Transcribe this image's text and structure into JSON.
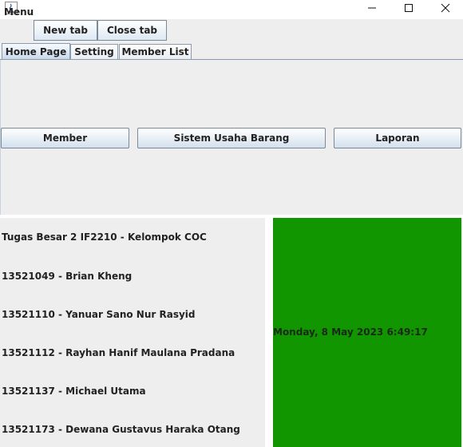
{
  "window": {
    "controls": [
      "minimize-icon",
      "maximize-icon",
      "close-icon"
    ]
  },
  "menubar": {
    "menu_label": "Menu",
    "new_tab_label": "New tab",
    "close_tab_label": "Close tab"
  },
  "tabs": [
    {
      "label": "Home Page",
      "active": true
    },
    {
      "label": "Setting",
      "active": false
    },
    {
      "label": "Member List",
      "active": false
    }
  ],
  "home": {
    "buttons": {
      "member": "Member",
      "sistem_usaha_barang": "Sistem Usaha Barang",
      "laporan": "Laporan"
    },
    "info_lines": [
      "Tugas Besar 2 IF2210 - Kelompok COC",
      "13521049 - Brian Kheng",
      "13521110 - Yanuar Sano Nur Rasyid",
      "13521112 - Rayhan Hanif Maulana Pradana",
      "13521137 - Michael Utama",
      "13521173 - Dewana Gustavus Haraka Otang"
    ],
    "clock_text": "Monday, 8 May 2023 6:49:17",
    "clock_panel_color": "#129600"
  }
}
